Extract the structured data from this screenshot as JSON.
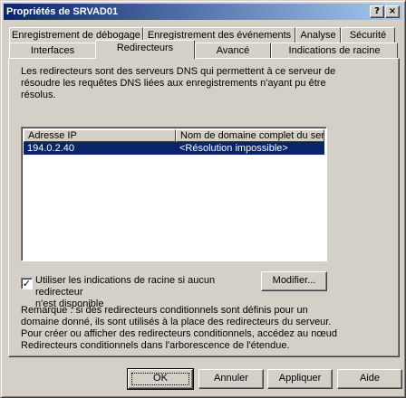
{
  "window": {
    "title": "Propriétés de SRVAD01",
    "help_glyph": "?",
    "close_glyph": "×"
  },
  "tabs": {
    "row1": [
      {
        "label": "Enregistrement de débogage"
      },
      {
        "label": "Enregistrement des événements"
      },
      {
        "label": "Analyse"
      },
      {
        "label": "Sécurité"
      }
    ],
    "row2": [
      {
        "label": "Interfaces"
      },
      {
        "label": "Redirecteurs"
      },
      {
        "label": "Avancé"
      },
      {
        "label": "Indications de racine"
      }
    ],
    "active": "Redirecteurs"
  },
  "panel": {
    "description": "Les redirecteurs sont des serveurs DNS qui permettent à ce serveur de résoudre les requêtes DNS liées aux enregistrements n'ayant pu être résolus.",
    "list": {
      "columns": [
        "Adresse IP",
        "Nom de domaine complet du ser..."
      ],
      "rows": [
        {
          "ip": "194.0.2.40",
          "fqdn": "<Résolution impossible>"
        }
      ]
    },
    "checkbox": {
      "label_line1": "Utiliser les indications de racine si aucun redirecteur",
      "label_line2": "n'est disponible",
      "checked": true,
      "mark": "✓"
    },
    "modify_button": "Modifier...",
    "note": "Remarque : si des redirecteurs conditionnels sont définis pour un domaine donné, ils sont utilisés à la place des redirecteurs du serveur. Pour créer ou afficher des redirecteurs conditionnels, accédez au nœud Redirecteurs conditionnels dans l'arborescence de l'étendue."
  },
  "buttons": {
    "ok": "OK",
    "cancel": "Annuler",
    "apply": "Appliquer",
    "help": "Aide"
  },
  "colors": {
    "face": "#d4d0c8",
    "selection": "#0a246a",
    "title_start": "#0a246a",
    "title_end": "#a6caf0"
  }
}
